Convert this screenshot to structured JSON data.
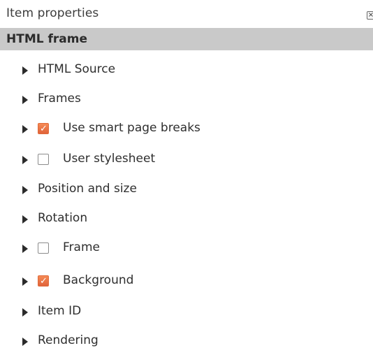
{
  "panel": {
    "title": "Item properties",
    "close_icon": "×",
    "section_title": "HTML frame"
  },
  "groups": [
    {
      "label": "HTML Source",
      "checkbox": null
    },
    {
      "label": "Frames",
      "checkbox": null
    },
    {
      "label": "Use smart page breaks",
      "checkbox": "checked"
    },
    {
      "label": "User stylesheet",
      "checkbox": "unchecked"
    },
    {
      "label": "Position and size",
      "checkbox": null
    },
    {
      "label": "Rotation",
      "checkbox": null
    },
    {
      "label": "Frame",
      "checkbox": "unchecked"
    },
    {
      "label": "Background",
      "checkbox": "checked"
    },
    {
      "label": "Item ID",
      "checkbox": null
    },
    {
      "label": "Rendering",
      "checkbox": null
    }
  ],
  "colors": {
    "header_band": "#c9c9c9",
    "checkbox_checked": "#e9703f"
  }
}
